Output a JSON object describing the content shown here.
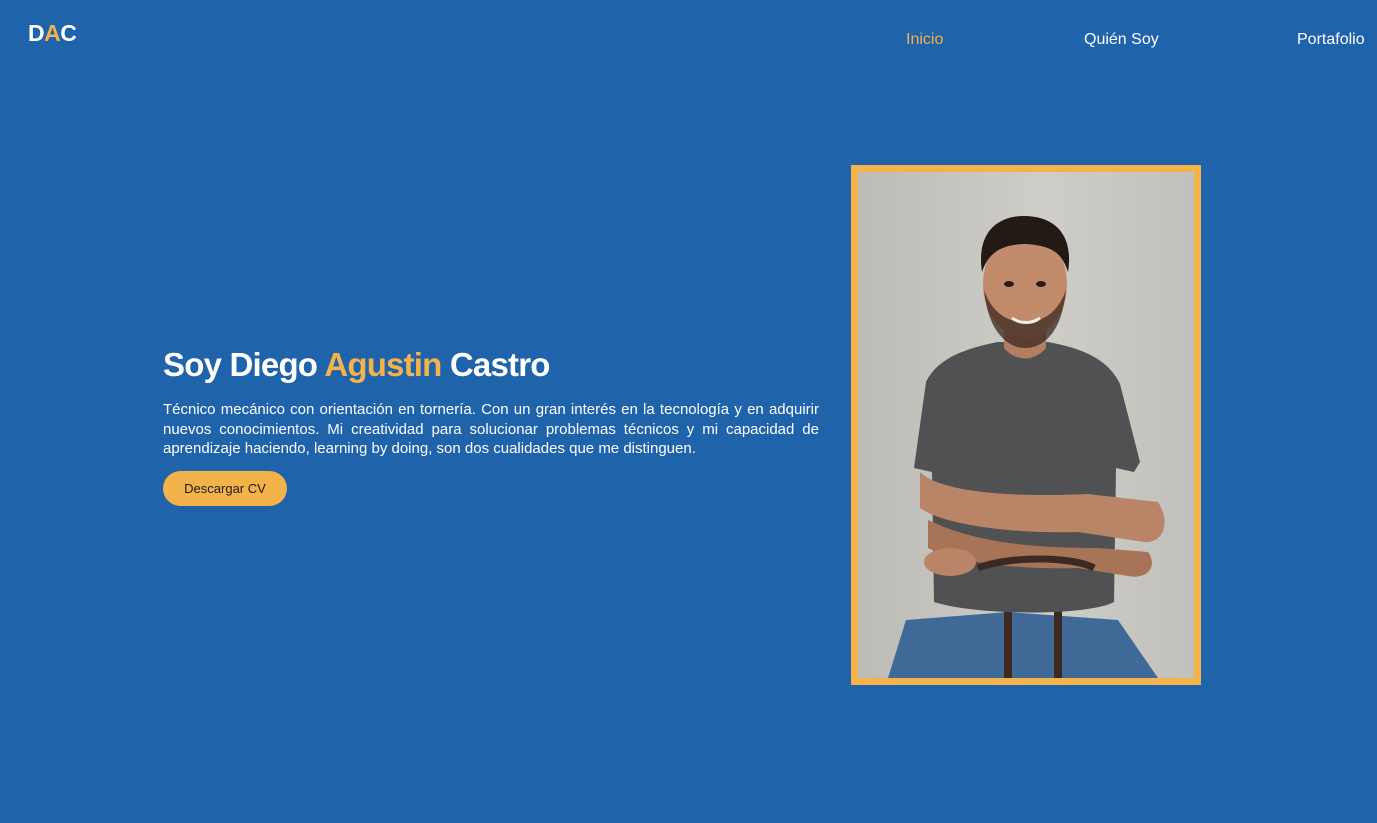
{
  "header": {
    "logo": {
      "part1": "D",
      "part2": "A",
      "part3": "C"
    },
    "nav": [
      {
        "label": "Inicio",
        "active": true
      },
      {
        "label": "Quién Soy",
        "active": false
      },
      {
        "label": "Portafolio",
        "active": false
      }
    ]
  },
  "hero": {
    "title_prefix": "Soy Diego ",
    "title_accent": "Agustin",
    "title_suffix": " Castro",
    "description": "Técnico mecánico con orientación en tornería. Con un gran interés en la tecnología y en adquirir nuevos conocimientos. Mi creatividad para solucionar problemas técnicos y mi capacidad de aprendizaje haciendo, learning by doing, son dos cualidades que me distinguen.",
    "cta_label": "Descargar CV"
  },
  "colors": {
    "background": "#1f63aa",
    "accent": "#f3b34a",
    "text": "#ffffff"
  }
}
